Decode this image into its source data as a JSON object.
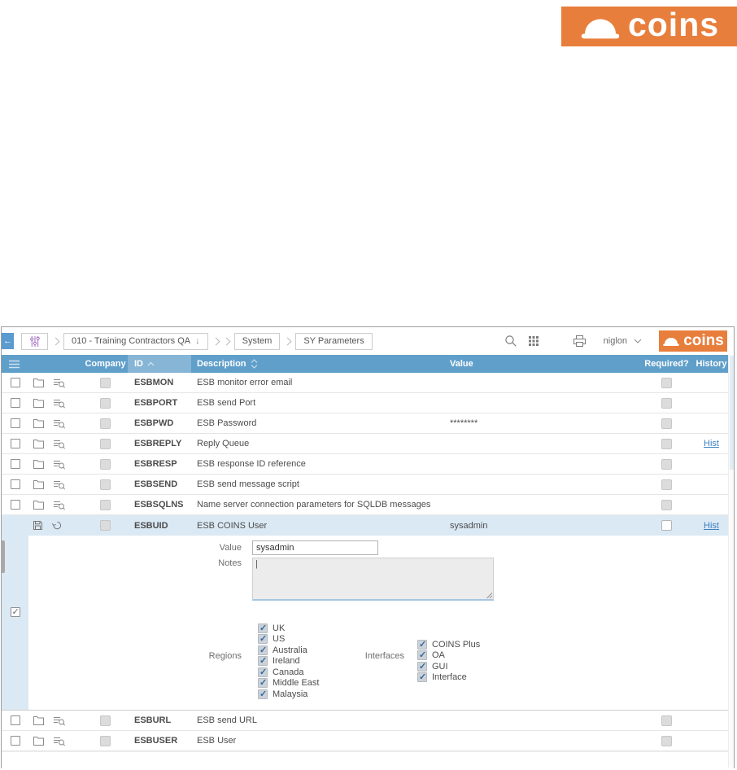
{
  "brand": {
    "name": "coins"
  },
  "toolbar": {
    "breadcrumb": {
      "company": "010 - Training Contractors QA",
      "module": "System",
      "page": "SY Parameters"
    },
    "user": "niglon"
  },
  "table": {
    "headers": {
      "company": "Company",
      "id": "ID",
      "description": "Description",
      "value": "Value",
      "required": "Required?",
      "history": "History"
    },
    "rows": [
      {
        "id": "ESBMON",
        "description": "ESB monitor error email",
        "value": "",
        "hist": ""
      },
      {
        "id": "ESBPORT",
        "description": "ESB send Port",
        "value": "",
        "hist": ""
      },
      {
        "id": "ESBPWD",
        "description": "ESB Password",
        "value": "********",
        "hist": ""
      },
      {
        "id": "ESBREPLY",
        "description": "Reply Queue",
        "value": "",
        "hist": "Hist"
      },
      {
        "id": "ESBRESP",
        "description": "ESB response ID reference",
        "value": "",
        "hist": ""
      },
      {
        "id": "ESBSEND",
        "description": "ESB send message script",
        "value": "",
        "hist": ""
      },
      {
        "id": "ESBSQLNS",
        "description": "Name server connection parameters for SQLDB messages",
        "value": "",
        "hist": ""
      },
      {
        "id": "ESBUID",
        "description": "ESB COINS User",
        "value": "sysadmin",
        "hist": "Hist"
      },
      {
        "id": "ESBURL",
        "description": "ESB send URL",
        "value": "",
        "hist": ""
      },
      {
        "id": "ESBUSER",
        "description": "ESB User",
        "value": "",
        "hist": ""
      }
    ]
  },
  "detail": {
    "value_label": "Value",
    "value": "sysadmin",
    "notes_label": "Notes",
    "notes": "",
    "regions_label": "Regions",
    "regions": [
      "UK",
      "US",
      "Australia",
      "Ireland",
      "Canada",
      "Middle East",
      "Malaysia"
    ],
    "interfaces_label": "Interfaces",
    "interfaces": [
      "COINS Plus",
      "OA",
      "GUI",
      "Interface"
    ]
  },
  "colors": {
    "brand_orange": "#e87e3c",
    "header_blue": "#609fca",
    "sorted_column_blue": "#86b5d5",
    "selected_row_blue": "#dbe9f4",
    "link_blue": "#3d7fc0"
  }
}
